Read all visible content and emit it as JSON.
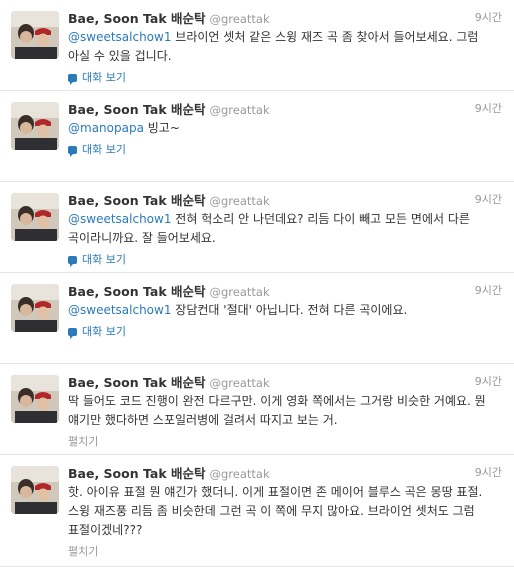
{
  "tweets": [
    {
      "name": "Bae, Soon Tak 배순탁",
      "handle": "@greattak",
      "time": "9시간",
      "mention": "@sweetsalchow1",
      "body": " 브라이언 셋처 같은 스윙 재즈 곡 좀 찾아서 들어보세요. 그럼 아실 수 있을 겁니다.",
      "action": "대화 보기"
    },
    {
      "name": "Bae, Soon Tak 배순탁",
      "handle": "@greattak",
      "time": "9시간",
      "mention": "@manopapa",
      "body": " 빙고~",
      "action": "대화 보기"
    },
    {
      "name": "Bae, Soon Tak 배순탁",
      "handle": "@greattak",
      "time": "9시간",
      "mention": "@sweetsalchow1",
      "body": " 전혀 헉소리 안 나던데요? 리듬 다이 빼고 모든 면에서 다른 곡이라니까요. 잘 들어보세요.",
      "action": "대화 보기"
    },
    {
      "name": "Bae, Soon Tak 배순탁",
      "handle": "@greattak",
      "time": "9시간",
      "mention": "@sweetsalchow1",
      "body": " 장담컨대 '절대' 아닙니다. 전혀 다른 곡이에요.",
      "action": "대화 보기"
    },
    {
      "name": "Bae, Soon Tak 배순탁",
      "handle": "@greattak",
      "time": "9시간",
      "mention": "",
      "body": "딱 들어도 코드 진행이 완전 다르구만. 이게 영화 쪽에서는 그거랑 비슷한 거예요. 뭔 얘기만 했다하면 스포일러병에 걸려서 따지고 보는 거.",
      "action": "펼치기"
    },
    {
      "name": "Bae, Soon Tak 배순탁",
      "handle": "@greattak",
      "time": "9시간",
      "mention": "",
      "body": "핫. 아이유 표절 뭔 얘긴가 했더니. 이게 표절이면 존 메이어 블루스 곡은 몽땅 표절. 스윙 재즈풍 리듬 좀 비슷한데 그런 곡 이 쪽에 무지 많아요. 브라이언 셋처도 그럼 표절이겠네???",
      "action": "펼치기"
    }
  ]
}
